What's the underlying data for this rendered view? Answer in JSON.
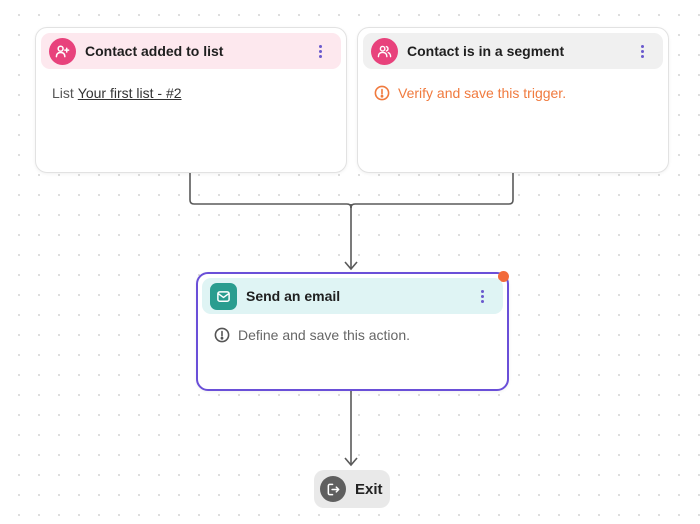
{
  "triggers": [
    {
      "title": "Contact added to list",
      "icon": "user-plus-icon",
      "header_color": "#fde8ee",
      "icon_color": "#e8427c",
      "body_label": "List",
      "body_link": "Your first list - #2"
    },
    {
      "title": "Contact is in a segment",
      "icon": "users-icon",
      "header_color": "#f0f0f0",
      "icon_color": "#e8427c",
      "warning": "Verify and save this trigger.",
      "warning_color": "#f07a3e"
    }
  ],
  "action": {
    "title": "Send an email",
    "icon": "mail-icon",
    "header_color": "#dff4f4",
    "icon_color": "#2a9d8f",
    "border_color": "#6a4fd8",
    "status_dot_color": "#f26b3a",
    "message": "Define and save this action."
  },
  "exit": {
    "label": "Exit",
    "icon": "exit-icon"
  }
}
